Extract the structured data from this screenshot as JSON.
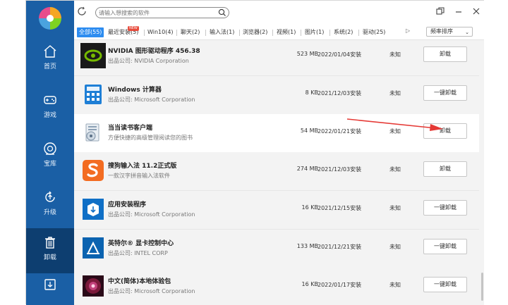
{
  "sidebar": {
    "items": [
      {
        "label": "首页",
        "icon": "home-icon"
      },
      {
        "label": "游戏",
        "icon": "gamepad-icon"
      },
      {
        "label": "宝库",
        "icon": "treasure-icon"
      },
      {
        "label": "升级",
        "icon": "upgrade-icon"
      },
      {
        "label": "卸载",
        "icon": "trash-icon",
        "active": true
      },
      {
        "label": "",
        "icon": "download-icon"
      }
    ]
  },
  "search": {
    "placeholder": "请输入想搜索的软件"
  },
  "tabs": [
    {
      "label": "全部(55)",
      "active": true
    },
    {
      "label": "最近安装(5)",
      "badge": "NEW"
    },
    {
      "label": "Win10(4)"
    },
    {
      "label": "聊天(2)"
    },
    {
      "label": "输入法(1)"
    },
    {
      "label": "浏览器(2)"
    },
    {
      "label": "视频(1)"
    },
    {
      "label": "图片(1)"
    },
    {
      "label": "系统(2)"
    },
    {
      "label": "驱动(25)"
    }
  ],
  "tabs_more": "▷",
  "sort": {
    "label": "频率排序",
    "chevron": "⌄"
  },
  "apps": [
    {
      "name": "NVIDIA 图形驱动程序 456.38",
      "publisher": "出品公司: NVIDIA Corporation",
      "size": "523 MB",
      "date": "2022/01/04安装",
      "status": "未知",
      "button": "卸载",
      "icon": "nvidia-icon"
    },
    {
      "name": "Windows 计算器",
      "publisher": "出品公司: Microsoft Corporation",
      "size": "8 KB",
      "date": "2021/12/03安装",
      "status": "未知",
      "button": "一键卸载",
      "icon": "calculator-icon"
    },
    {
      "name": "当当读书客户端",
      "publisher": "方便快捷的高级管理阅读您的图书",
      "size": "54 MB",
      "date": "2022/01/21安装",
      "status": "未知",
      "button": "卸载",
      "icon": "book-reader-icon",
      "highlighted": true
    },
    {
      "name": "搜狗输入法 11.2正式版",
      "publisher": "一款汉字拼音输入法软件",
      "size": "274 MB",
      "date": "2021/12/03安装",
      "status": "未知",
      "button": "卸载",
      "icon": "sogou-icon"
    },
    {
      "name": "应用安装程序",
      "publisher": "出品公司: Microsoft Corporation",
      "size": "16 KB",
      "date": "2021/12/15安装",
      "status": "未知",
      "button": "一键卸载",
      "icon": "app-installer-icon"
    },
    {
      "name": "英特尔® 显卡控制中心",
      "publisher": "出品公司: INTEL CORP",
      "size": "133 MB",
      "date": "2021/12/21安装",
      "status": "未知",
      "button": "一键卸载",
      "icon": "intel-graphics-icon"
    },
    {
      "name": "中文(简体)本地体验包",
      "publisher": "出品公司: Microsoft Corporation",
      "size": "16 KB",
      "date": "2022/01/17安装",
      "status": "未知",
      "button": "一键卸载",
      "icon": "language-pack-icon"
    }
  ],
  "colors": {
    "sidebar": "#1a5fa5",
    "sidebar_active": "#0d3e70",
    "accent": "#2d8cf0",
    "arrow": "#e53935"
  }
}
